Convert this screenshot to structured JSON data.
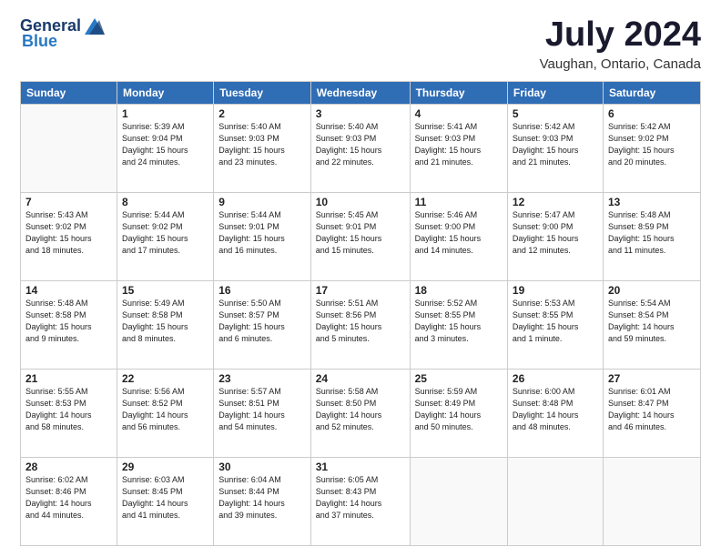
{
  "header": {
    "logo_general": "General",
    "logo_blue": "Blue",
    "month": "July 2024",
    "location": "Vaughan, Ontario, Canada"
  },
  "days_of_week": [
    "Sunday",
    "Monday",
    "Tuesday",
    "Wednesday",
    "Thursday",
    "Friday",
    "Saturday"
  ],
  "weeks": [
    [
      {
        "day": "",
        "text": ""
      },
      {
        "day": "1",
        "text": "Sunrise: 5:39 AM\nSunset: 9:04 PM\nDaylight: 15 hours\nand 24 minutes."
      },
      {
        "day": "2",
        "text": "Sunrise: 5:40 AM\nSunset: 9:03 PM\nDaylight: 15 hours\nand 23 minutes."
      },
      {
        "day": "3",
        "text": "Sunrise: 5:40 AM\nSunset: 9:03 PM\nDaylight: 15 hours\nand 22 minutes."
      },
      {
        "day": "4",
        "text": "Sunrise: 5:41 AM\nSunset: 9:03 PM\nDaylight: 15 hours\nand 21 minutes."
      },
      {
        "day": "5",
        "text": "Sunrise: 5:42 AM\nSunset: 9:03 PM\nDaylight: 15 hours\nand 21 minutes."
      },
      {
        "day": "6",
        "text": "Sunrise: 5:42 AM\nSunset: 9:02 PM\nDaylight: 15 hours\nand 20 minutes."
      }
    ],
    [
      {
        "day": "7",
        "text": "Sunrise: 5:43 AM\nSunset: 9:02 PM\nDaylight: 15 hours\nand 18 minutes."
      },
      {
        "day": "8",
        "text": "Sunrise: 5:44 AM\nSunset: 9:02 PM\nDaylight: 15 hours\nand 17 minutes."
      },
      {
        "day": "9",
        "text": "Sunrise: 5:44 AM\nSunset: 9:01 PM\nDaylight: 15 hours\nand 16 minutes."
      },
      {
        "day": "10",
        "text": "Sunrise: 5:45 AM\nSunset: 9:01 PM\nDaylight: 15 hours\nand 15 minutes."
      },
      {
        "day": "11",
        "text": "Sunrise: 5:46 AM\nSunset: 9:00 PM\nDaylight: 15 hours\nand 14 minutes."
      },
      {
        "day": "12",
        "text": "Sunrise: 5:47 AM\nSunset: 9:00 PM\nDaylight: 15 hours\nand 12 minutes."
      },
      {
        "day": "13",
        "text": "Sunrise: 5:48 AM\nSunset: 8:59 PM\nDaylight: 15 hours\nand 11 minutes."
      }
    ],
    [
      {
        "day": "14",
        "text": "Sunrise: 5:48 AM\nSunset: 8:58 PM\nDaylight: 15 hours\nand 9 minutes."
      },
      {
        "day": "15",
        "text": "Sunrise: 5:49 AM\nSunset: 8:58 PM\nDaylight: 15 hours\nand 8 minutes."
      },
      {
        "day": "16",
        "text": "Sunrise: 5:50 AM\nSunset: 8:57 PM\nDaylight: 15 hours\nand 6 minutes."
      },
      {
        "day": "17",
        "text": "Sunrise: 5:51 AM\nSunset: 8:56 PM\nDaylight: 15 hours\nand 5 minutes."
      },
      {
        "day": "18",
        "text": "Sunrise: 5:52 AM\nSunset: 8:55 PM\nDaylight: 15 hours\nand 3 minutes."
      },
      {
        "day": "19",
        "text": "Sunrise: 5:53 AM\nSunset: 8:55 PM\nDaylight: 15 hours\nand 1 minute."
      },
      {
        "day": "20",
        "text": "Sunrise: 5:54 AM\nSunset: 8:54 PM\nDaylight: 14 hours\nand 59 minutes."
      }
    ],
    [
      {
        "day": "21",
        "text": "Sunrise: 5:55 AM\nSunset: 8:53 PM\nDaylight: 14 hours\nand 58 minutes."
      },
      {
        "day": "22",
        "text": "Sunrise: 5:56 AM\nSunset: 8:52 PM\nDaylight: 14 hours\nand 56 minutes."
      },
      {
        "day": "23",
        "text": "Sunrise: 5:57 AM\nSunset: 8:51 PM\nDaylight: 14 hours\nand 54 minutes."
      },
      {
        "day": "24",
        "text": "Sunrise: 5:58 AM\nSunset: 8:50 PM\nDaylight: 14 hours\nand 52 minutes."
      },
      {
        "day": "25",
        "text": "Sunrise: 5:59 AM\nSunset: 8:49 PM\nDaylight: 14 hours\nand 50 minutes."
      },
      {
        "day": "26",
        "text": "Sunrise: 6:00 AM\nSunset: 8:48 PM\nDaylight: 14 hours\nand 48 minutes."
      },
      {
        "day": "27",
        "text": "Sunrise: 6:01 AM\nSunset: 8:47 PM\nDaylight: 14 hours\nand 46 minutes."
      }
    ],
    [
      {
        "day": "28",
        "text": "Sunrise: 6:02 AM\nSunset: 8:46 PM\nDaylight: 14 hours\nand 44 minutes."
      },
      {
        "day": "29",
        "text": "Sunrise: 6:03 AM\nSunset: 8:45 PM\nDaylight: 14 hours\nand 41 minutes."
      },
      {
        "day": "30",
        "text": "Sunrise: 6:04 AM\nSunset: 8:44 PM\nDaylight: 14 hours\nand 39 minutes."
      },
      {
        "day": "31",
        "text": "Sunrise: 6:05 AM\nSunset: 8:43 PM\nDaylight: 14 hours\nand 37 minutes."
      },
      {
        "day": "",
        "text": ""
      },
      {
        "day": "",
        "text": ""
      },
      {
        "day": "",
        "text": ""
      }
    ]
  ]
}
